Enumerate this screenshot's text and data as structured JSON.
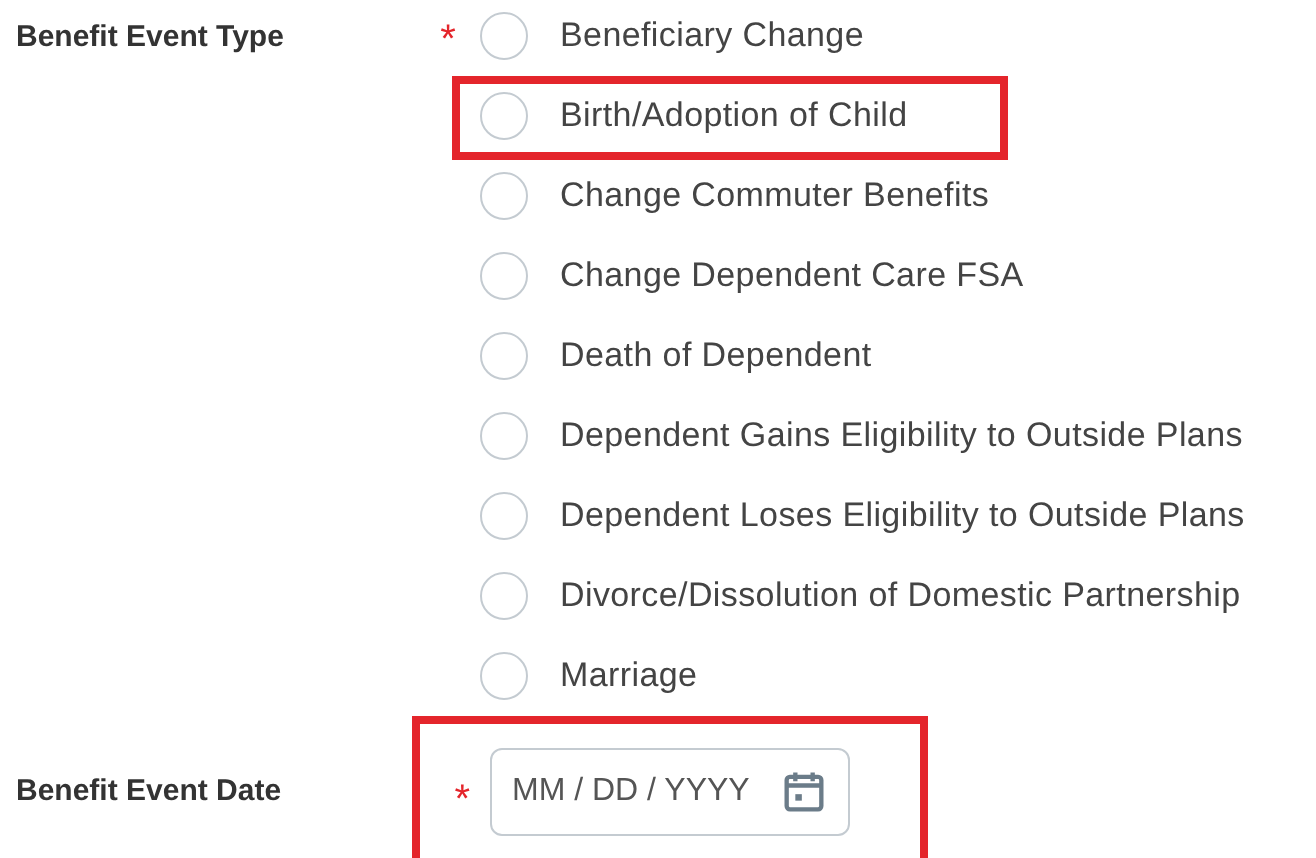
{
  "event_type": {
    "label": "Benefit Event Type",
    "required": true,
    "required_mark": "*",
    "options": [
      {
        "label": "Beneficiary Change",
        "selected": false,
        "highlighted": false
      },
      {
        "label": "Birth/Adoption of Child",
        "selected": false,
        "highlighted": true
      },
      {
        "label": "Change Commuter Benefits",
        "selected": false,
        "highlighted": false
      },
      {
        "label": "Change Dependent Care FSA",
        "selected": false,
        "highlighted": false
      },
      {
        "label": "Death of Dependent",
        "selected": false,
        "highlighted": false
      },
      {
        "label": "Dependent Gains Eligibility to Outside Plans",
        "selected": false,
        "highlighted": false
      },
      {
        "label": "Dependent Loses Eligibility to Outside Plans",
        "selected": false,
        "highlighted": false
      },
      {
        "label": "Divorce/Dissolution of Domestic Partnership",
        "selected": false,
        "highlighted": false
      },
      {
        "label": "Marriage",
        "selected": false,
        "highlighted": false
      }
    ]
  },
  "event_date": {
    "label": "Benefit Event Date",
    "required": true,
    "required_mark": "*",
    "placeholder": "MM / DD / YYYY",
    "highlighted": true
  }
}
